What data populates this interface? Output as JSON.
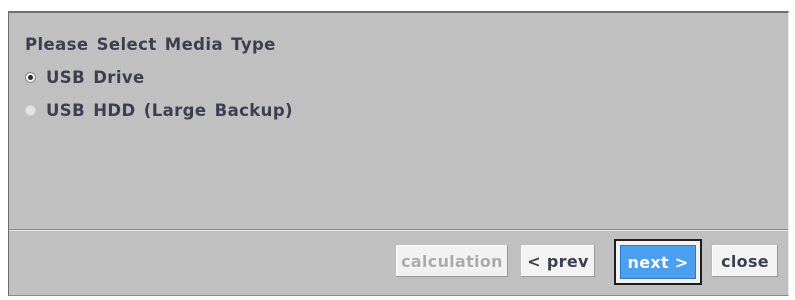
{
  "dialog": {
    "title": "Please Select Media Type",
    "options": [
      {
        "label": "USB Drive",
        "selected": true
      },
      {
        "label": "USB HDD (Large Backup)",
        "selected": false
      }
    ],
    "buttons": {
      "calculation": "calculation",
      "prev": "< prev",
      "next": "next >",
      "close": "close"
    }
  },
  "colors": {
    "panel_bg": "#c0c0c0",
    "text": "#3c3f52",
    "accent": "#4a9ff0",
    "disabled_text": "#a9a9a9"
  }
}
